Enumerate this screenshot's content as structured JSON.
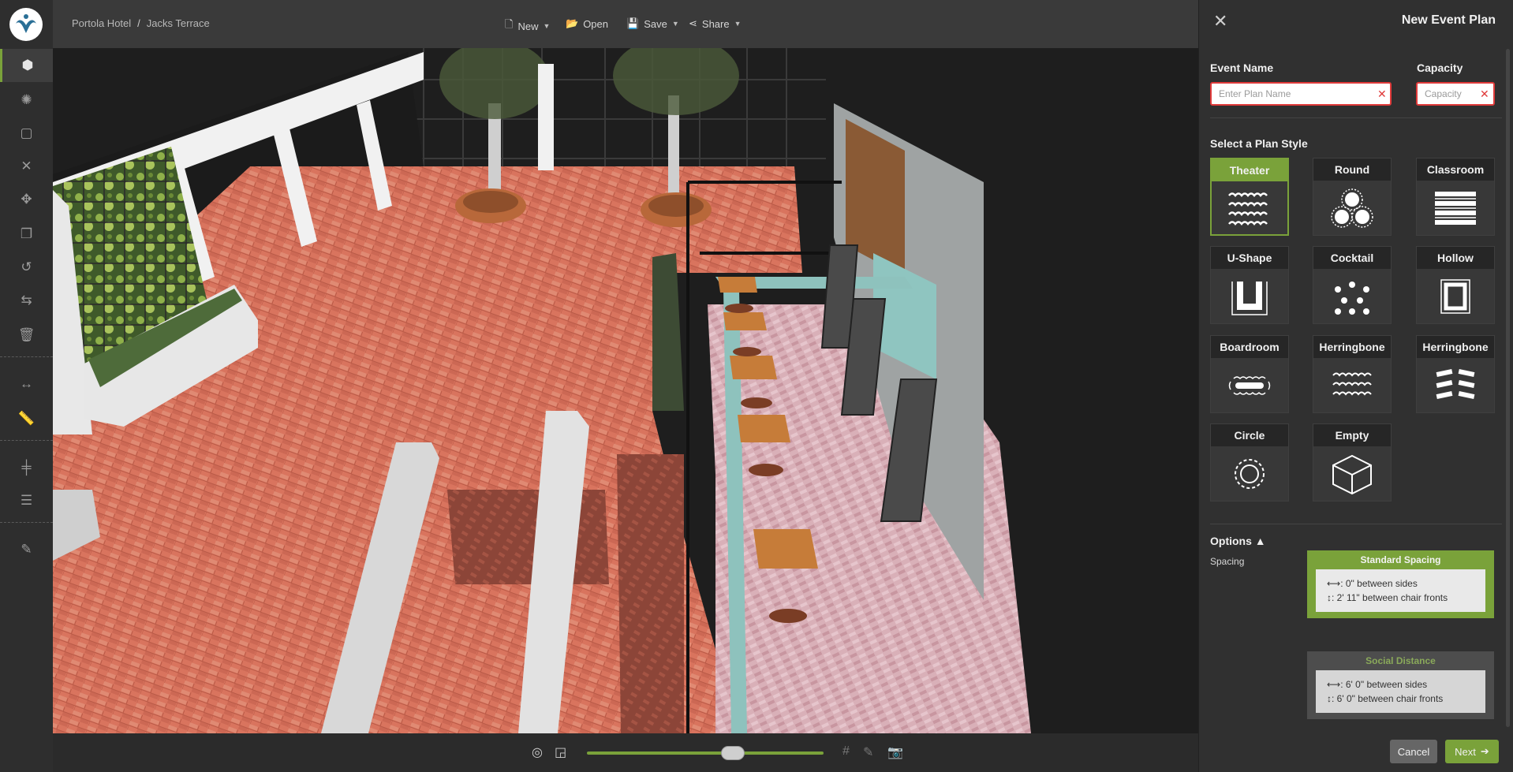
{
  "breadcrumb": {
    "venue": "Portola Hotel",
    "separator": "/",
    "space": "Jacks Terrace"
  },
  "toolbar": {
    "new_label": "New",
    "open_label": "Open",
    "save_label": "Save",
    "share_label": "Share"
  },
  "left_tools": [
    {
      "name": "3d-view-icon",
      "glyph": "⬢",
      "active": true
    },
    {
      "name": "light-icon",
      "glyph": "✺"
    },
    {
      "name": "select-area-icon",
      "glyph": "▢"
    },
    {
      "name": "delete-x-icon",
      "glyph": "✕"
    },
    {
      "name": "move-icon",
      "glyph": "✥"
    },
    {
      "name": "copy-icon",
      "glyph": "❐"
    },
    {
      "name": "undo-icon",
      "glyph": "↺"
    },
    {
      "name": "swap-icon",
      "glyph": "⇆"
    },
    {
      "name": "trash-icon",
      "glyph": "🗑"
    },
    {
      "name": "width-arrows-icon",
      "glyph": "↔"
    },
    {
      "name": "ruler-icon",
      "glyph": "📏"
    },
    {
      "name": "align-center-icon",
      "glyph": "╪"
    },
    {
      "name": "distribute-icon",
      "glyph": "☰"
    },
    {
      "name": "edit-icon",
      "glyph": "✎"
    }
  ],
  "panel": {
    "title": "New Event Plan",
    "close_glyph": "✕",
    "event_name_label": "Event Name",
    "event_name_placeholder": "Enter Plan Name",
    "event_name_value": "",
    "capacity_label": "Capacity",
    "capacity_placeholder": "Capacity",
    "capacity_value": "",
    "clear_glyph": "✕",
    "plan_style_label": "Select a Plan Style",
    "styles": [
      {
        "label": "Theater",
        "selected": true
      },
      {
        "label": "Round"
      },
      {
        "label": "Classroom"
      },
      {
        "label": "U-Shape"
      },
      {
        "label": "Cocktail"
      },
      {
        "label": "Hollow"
      },
      {
        "label": "Boardroom"
      },
      {
        "label": "Herringbone"
      },
      {
        "label": "Herringbone"
      },
      {
        "label": "Circle"
      },
      {
        "label": "Empty"
      }
    ],
    "options_label": "Options",
    "options_caret": "▲",
    "spacing_label": "Spacing",
    "spacing": [
      {
        "title": "Standard Spacing",
        "line1": ": 0\" between sides",
        "line2": ": 2' 11\" between chair fronts",
        "selected": true
      },
      {
        "title": "Social Distance",
        "line1": ": 6' 0\" between sides",
        "line2": ": 6' 0\" between chair fronts"
      }
    ],
    "cancel_label": "Cancel",
    "next_label": "Next"
  },
  "viewer": {
    "zoom_fraction": 0.63
  },
  "colors": {
    "accent": "#7aa23a",
    "danger": "#e03a3a",
    "panel_bg": "#303030",
    "topbar_bg": "#3a3a3a"
  }
}
